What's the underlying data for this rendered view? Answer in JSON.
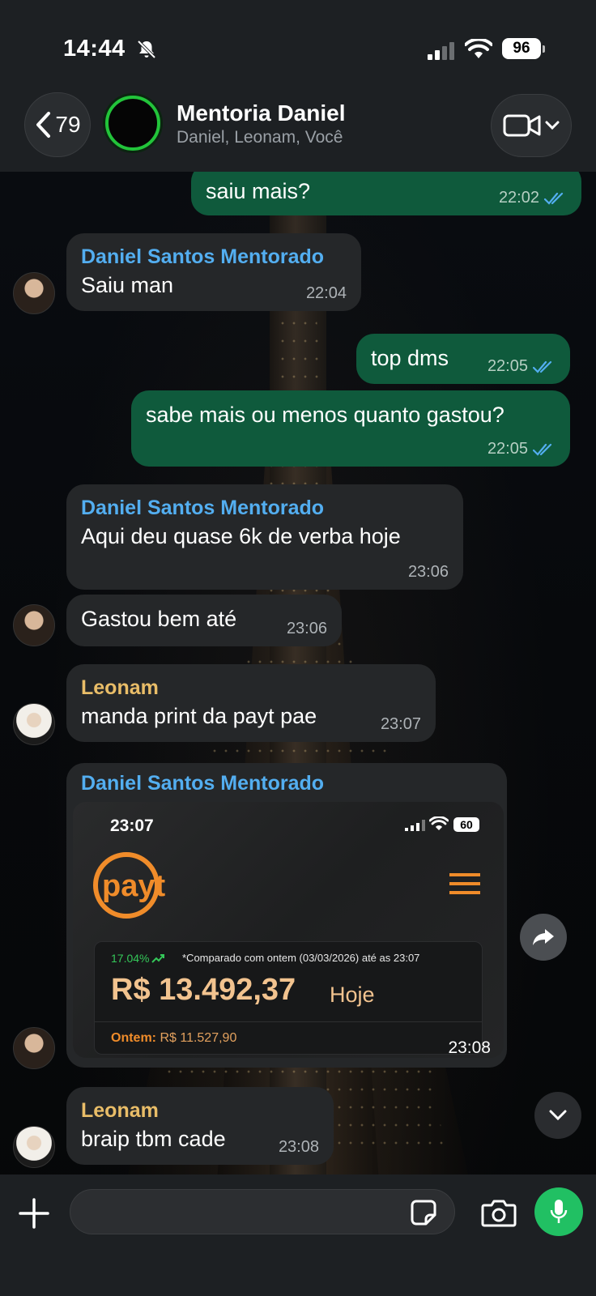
{
  "status_bar": {
    "time": "14:44",
    "battery": "96"
  },
  "header": {
    "back_count": "79",
    "title": "Mentoria Daniel",
    "subtitle": "Daniel, Leonam, Você"
  },
  "messages": [
    {
      "dir": "out",
      "text": "saiu mais?",
      "time": "22:02"
    },
    {
      "dir": "in",
      "sender": "Daniel Santos Mentorado",
      "text": "Saiu man",
      "time": "22:04"
    },
    {
      "dir": "out",
      "text": "top dms",
      "time": "22:05"
    },
    {
      "dir": "out",
      "text": "sabe mais ou menos quanto gastou?",
      "time": "22:05"
    },
    {
      "dir": "in",
      "sender": "Daniel Santos Mentorado",
      "text": "Aqui deu quase 6k de verba hoje",
      "time": "23:06"
    },
    {
      "dir": "in",
      "text": "Gastou bem até",
      "time": "23:06"
    },
    {
      "dir": "in",
      "sender": "Leonam",
      "text": "manda print da payt pae",
      "time": "23:07"
    },
    {
      "dir": "in",
      "sender": "Daniel Santos Mentorado",
      "time": "23:08"
    },
    {
      "dir": "in",
      "sender": "Leonam",
      "text": "braip tbm cade",
      "time": "23:08"
    }
  ],
  "screenshot": {
    "time": "23:07",
    "battery": "60",
    "logo_text": "payt",
    "percent": "17.04%",
    "compare_text": "*Comparado com ontem (03/03/2026) até as 23:07",
    "amount": "R$ 13.492,37",
    "today_label": "Hoje",
    "yesterday_label": "Ontem:",
    "yesterday_value": "R$ 11.527,90"
  },
  "input": {
    "placeholder": ""
  },
  "colors": {
    "outgoing_bubble": "#0f5a3c",
    "incoming_bubble": "#252729",
    "sender_daniel": "#53aef0",
    "sender_leonam": "#e9bd68",
    "accent_green": "#21c063",
    "payt_orange": "#f08c2a"
  },
  "icons": [
    "bell-off-icon",
    "signal-icon",
    "wifi-icon",
    "battery-icon",
    "back-chevron-icon",
    "video-icon",
    "chevron-down-icon",
    "share-icon",
    "plus-icon",
    "sticker-icon",
    "camera-icon",
    "mic-icon",
    "double-check-icon",
    "menu-icon"
  ]
}
